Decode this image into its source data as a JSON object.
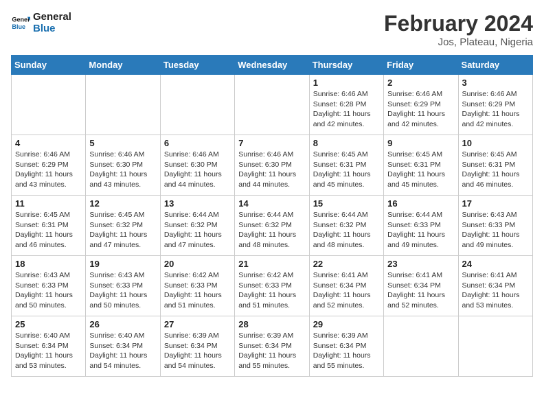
{
  "header": {
    "logo_line1": "General",
    "logo_line2": "Blue",
    "title": "February 2024",
    "subtitle": "Jos, Plateau, Nigeria"
  },
  "weekdays": [
    "Sunday",
    "Monday",
    "Tuesday",
    "Wednesday",
    "Thursday",
    "Friday",
    "Saturday"
  ],
  "weeks": [
    [
      {
        "day": "",
        "info": ""
      },
      {
        "day": "",
        "info": ""
      },
      {
        "day": "",
        "info": ""
      },
      {
        "day": "",
        "info": ""
      },
      {
        "day": "1",
        "info": "Sunrise: 6:46 AM\nSunset: 6:28 PM\nDaylight: 11 hours\nand 42 minutes."
      },
      {
        "day": "2",
        "info": "Sunrise: 6:46 AM\nSunset: 6:29 PM\nDaylight: 11 hours\nand 42 minutes."
      },
      {
        "day": "3",
        "info": "Sunrise: 6:46 AM\nSunset: 6:29 PM\nDaylight: 11 hours\nand 42 minutes."
      }
    ],
    [
      {
        "day": "4",
        "info": "Sunrise: 6:46 AM\nSunset: 6:29 PM\nDaylight: 11 hours\nand 43 minutes."
      },
      {
        "day": "5",
        "info": "Sunrise: 6:46 AM\nSunset: 6:30 PM\nDaylight: 11 hours\nand 43 minutes."
      },
      {
        "day": "6",
        "info": "Sunrise: 6:46 AM\nSunset: 6:30 PM\nDaylight: 11 hours\nand 44 minutes."
      },
      {
        "day": "7",
        "info": "Sunrise: 6:46 AM\nSunset: 6:30 PM\nDaylight: 11 hours\nand 44 minutes."
      },
      {
        "day": "8",
        "info": "Sunrise: 6:45 AM\nSunset: 6:31 PM\nDaylight: 11 hours\nand 45 minutes."
      },
      {
        "day": "9",
        "info": "Sunrise: 6:45 AM\nSunset: 6:31 PM\nDaylight: 11 hours\nand 45 minutes."
      },
      {
        "day": "10",
        "info": "Sunrise: 6:45 AM\nSunset: 6:31 PM\nDaylight: 11 hours\nand 46 minutes."
      }
    ],
    [
      {
        "day": "11",
        "info": "Sunrise: 6:45 AM\nSunset: 6:31 PM\nDaylight: 11 hours\nand 46 minutes."
      },
      {
        "day": "12",
        "info": "Sunrise: 6:45 AM\nSunset: 6:32 PM\nDaylight: 11 hours\nand 47 minutes."
      },
      {
        "day": "13",
        "info": "Sunrise: 6:44 AM\nSunset: 6:32 PM\nDaylight: 11 hours\nand 47 minutes."
      },
      {
        "day": "14",
        "info": "Sunrise: 6:44 AM\nSunset: 6:32 PM\nDaylight: 11 hours\nand 48 minutes."
      },
      {
        "day": "15",
        "info": "Sunrise: 6:44 AM\nSunset: 6:32 PM\nDaylight: 11 hours\nand 48 minutes."
      },
      {
        "day": "16",
        "info": "Sunrise: 6:44 AM\nSunset: 6:33 PM\nDaylight: 11 hours\nand 49 minutes."
      },
      {
        "day": "17",
        "info": "Sunrise: 6:43 AM\nSunset: 6:33 PM\nDaylight: 11 hours\nand 49 minutes."
      }
    ],
    [
      {
        "day": "18",
        "info": "Sunrise: 6:43 AM\nSunset: 6:33 PM\nDaylight: 11 hours\nand 50 minutes."
      },
      {
        "day": "19",
        "info": "Sunrise: 6:43 AM\nSunset: 6:33 PM\nDaylight: 11 hours\nand 50 minutes."
      },
      {
        "day": "20",
        "info": "Sunrise: 6:42 AM\nSunset: 6:33 PM\nDaylight: 11 hours\nand 51 minutes."
      },
      {
        "day": "21",
        "info": "Sunrise: 6:42 AM\nSunset: 6:33 PM\nDaylight: 11 hours\nand 51 minutes."
      },
      {
        "day": "22",
        "info": "Sunrise: 6:41 AM\nSunset: 6:34 PM\nDaylight: 11 hours\nand 52 minutes."
      },
      {
        "day": "23",
        "info": "Sunrise: 6:41 AM\nSunset: 6:34 PM\nDaylight: 11 hours\nand 52 minutes."
      },
      {
        "day": "24",
        "info": "Sunrise: 6:41 AM\nSunset: 6:34 PM\nDaylight: 11 hours\nand 53 minutes."
      }
    ],
    [
      {
        "day": "25",
        "info": "Sunrise: 6:40 AM\nSunset: 6:34 PM\nDaylight: 11 hours\nand 53 minutes."
      },
      {
        "day": "26",
        "info": "Sunrise: 6:40 AM\nSunset: 6:34 PM\nDaylight: 11 hours\nand 54 minutes."
      },
      {
        "day": "27",
        "info": "Sunrise: 6:39 AM\nSunset: 6:34 PM\nDaylight: 11 hours\nand 54 minutes."
      },
      {
        "day": "28",
        "info": "Sunrise: 6:39 AM\nSunset: 6:34 PM\nDaylight: 11 hours\nand 55 minutes."
      },
      {
        "day": "29",
        "info": "Sunrise: 6:39 AM\nSunset: 6:34 PM\nDaylight: 11 hours\nand 55 minutes."
      },
      {
        "day": "",
        "info": ""
      },
      {
        "day": "",
        "info": ""
      }
    ]
  ]
}
